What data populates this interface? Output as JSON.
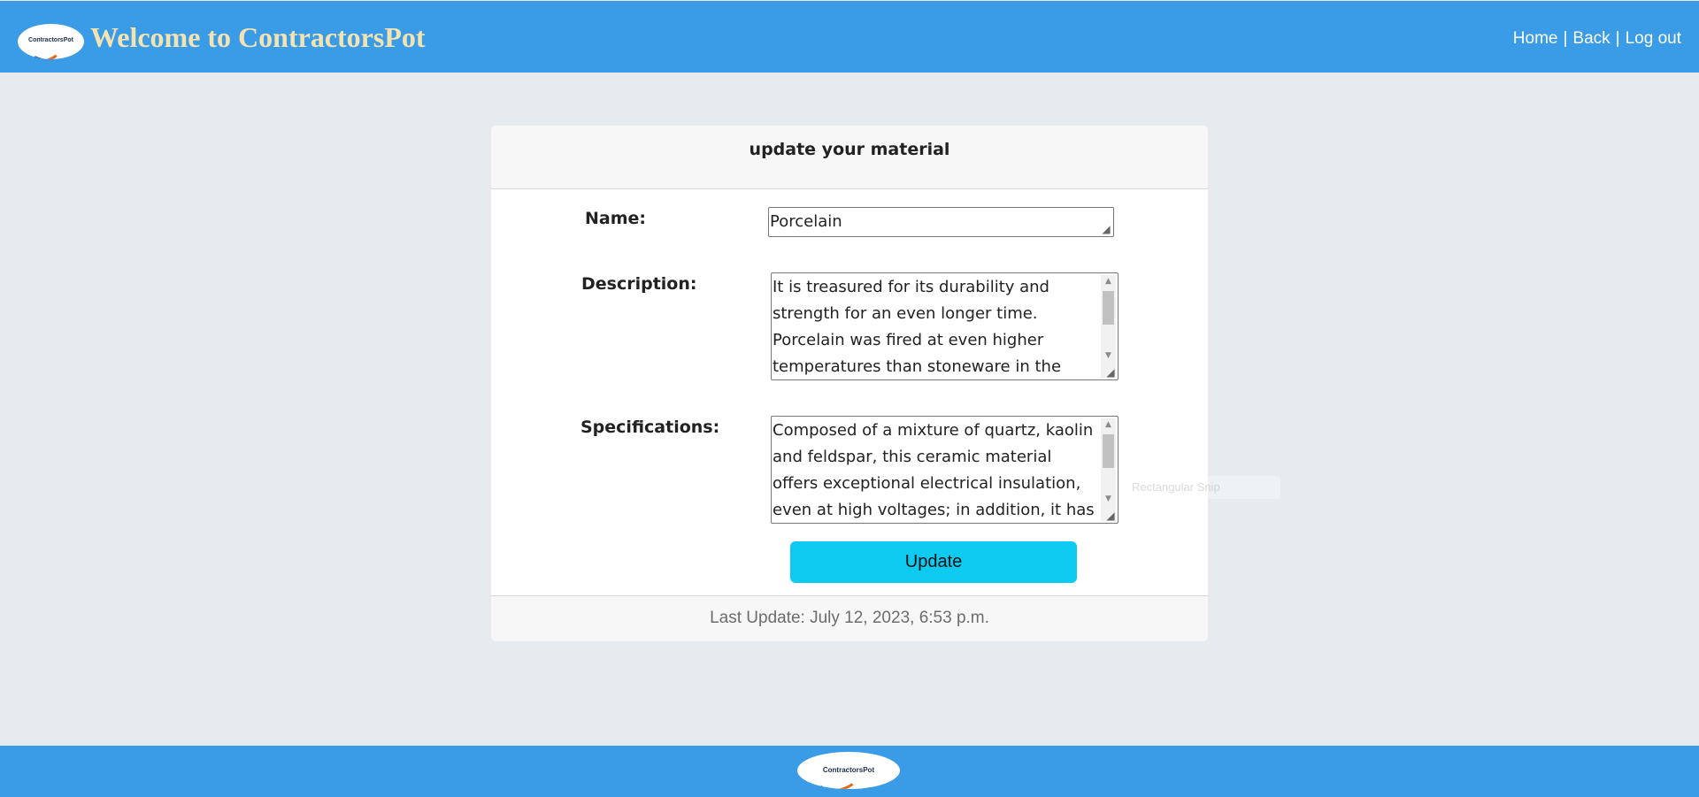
{
  "header": {
    "title": "Welcome to ContractorsPot",
    "logo_text": "ContractorsPot",
    "nav": [
      {
        "label": "Home"
      },
      {
        "label": "Back"
      },
      {
        "label": "Log out"
      }
    ],
    "nav_separator": "|"
  },
  "form": {
    "title": "update your material",
    "name": {
      "label": "Name:",
      "value": "Porcelain"
    },
    "description": {
      "label": "Description:",
      "value": "It is treasured for its durability and strength for an even longer time. Porcelain was fired at even higher temperatures than stoneware in the past."
    },
    "specifications": {
      "label": "Specifications:",
      "value": "Composed of a mixture of quartz, kaolin and feldspar, this ceramic material offers exceptional electrical insulation, even at high voltages; in addition, it has high"
    },
    "submit_label": "Update",
    "last_update": "Last Update: July 12, 2023, 6:53 p.m."
  },
  "tooltip": {
    "text": "Rectangular Snip"
  },
  "footer": {
    "logo_text": "ContractorsPot"
  },
  "colors": {
    "header_bg": "#3a9be6",
    "page_bg": "#e7ebef",
    "title_color": "#f3e3b0",
    "button_bg": "#0dcaf0"
  },
  "icons": {
    "scroll_up": "triangle-up-icon",
    "scroll_down": "triangle-down-icon",
    "resize": "resize-grip-icon"
  }
}
